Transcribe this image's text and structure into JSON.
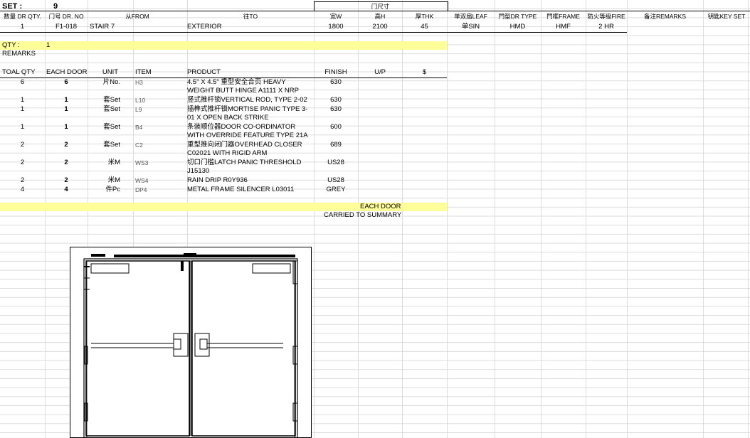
{
  "set": {
    "label": "SET :",
    "value": "9"
  },
  "header": {
    "group_label": "门尺寸",
    "cols": {
      "qty": "数量 DR QTY.",
      "no": "门号 DR. NO",
      "from": "从FROM",
      "to": "往TO",
      "w": "宽W",
      "h": "高H",
      "thk": "厚THK",
      "leaf": "单双扇LEAF",
      "type": "門型DR TYPE",
      "frame": "門框FRAME",
      "fire": "防火等级FIRE",
      "remarks": "备注REMARKS",
      "key": "钥匙KEY SET"
    }
  },
  "door": {
    "qty": "1",
    "no": "F1-018",
    "from": "STAIR 7",
    "to": "EXTERIOR",
    "w": "1800",
    "h": "2100",
    "thk": "45",
    "leaf": "单SIN",
    "type": "HMD",
    "frame": "HMF",
    "fire": "2 HR"
  },
  "qty_row": {
    "label": "QTY :",
    "value": "1"
  },
  "remarks_label": "REMARKS",
  "items_header": {
    "total": "TOAL QTY",
    "each": "EACH DOOR",
    "unit": "UNIT",
    "item": "ITEM",
    "product": "PRODUCT",
    "finish": "FINISH",
    "up": "U/P",
    "cur": "$"
  },
  "items": [
    {
      "total": "6",
      "each": "6",
      "unit": "片No.",
      "item": "H3",
      "product": "4.5\" X 4.5\"  重型安全合页 HEAVY WEIGHT BUTT HINGE A1111 X NRP",
      "finish": "630"
    },
    {
      "total": "1",
      "each": "1",
      "unit": "套Set",
      "item": "L10",
      "product": "竖式推杆锁VERTICAL ROD, TYPE 2-02",
      "finish": "630"
    },
    {
      "total": "1",
      "each": "1",
      "unit": "套Set",
      "item": "L9",
      "product": "插榫式推杆锁MORTISE PANIC TYPE 3-01 X OPEN BACK STRIKE",
      "finish": "630"
    },
    {
      "total": "1",
      "each": "1",
      "unit": "套Set",
      "item": "B4",
      "product": "条装顺位器DOOR CO-ORDINATOR WITH OVERRIDE FEATURE TYPE 21A",
      "finish": "600"
    },
    {
      "total": "2",
      "each": "2",
      "unit": "套Set",
      "item": "C2",
      "product": "重型推向闭门器OVERHEAD CLOSER C02021 WITH RIGID ARM",
      "finish": "689"
    },
    {
      "total": "2",
      "each": "2",
      "unit": "米M",
      "item": "WS3",
      "product": "切口门槛LATCH PANIC THRESHOLD J15130",
      "finish": "US28"
    },
    {
      "total": "2",
      "each": "2",
      "unit": "米M",
      "item": "WS4",
      "product": "RAIN DRIP R0Y936",
      "finish": "US28"
    },
    {
      "total": "4",
      "each": "4",
      "unit": "件Pc",
      "item": "DP4",
      "product": "METAL FRAME SILENCER L03011",
      "finish": "GREY"
    }
  ],
  "footer": {
    "each_door": "EACH DOOR",
    "carried": "CARRIED TO SUMMARY"
  }
}
